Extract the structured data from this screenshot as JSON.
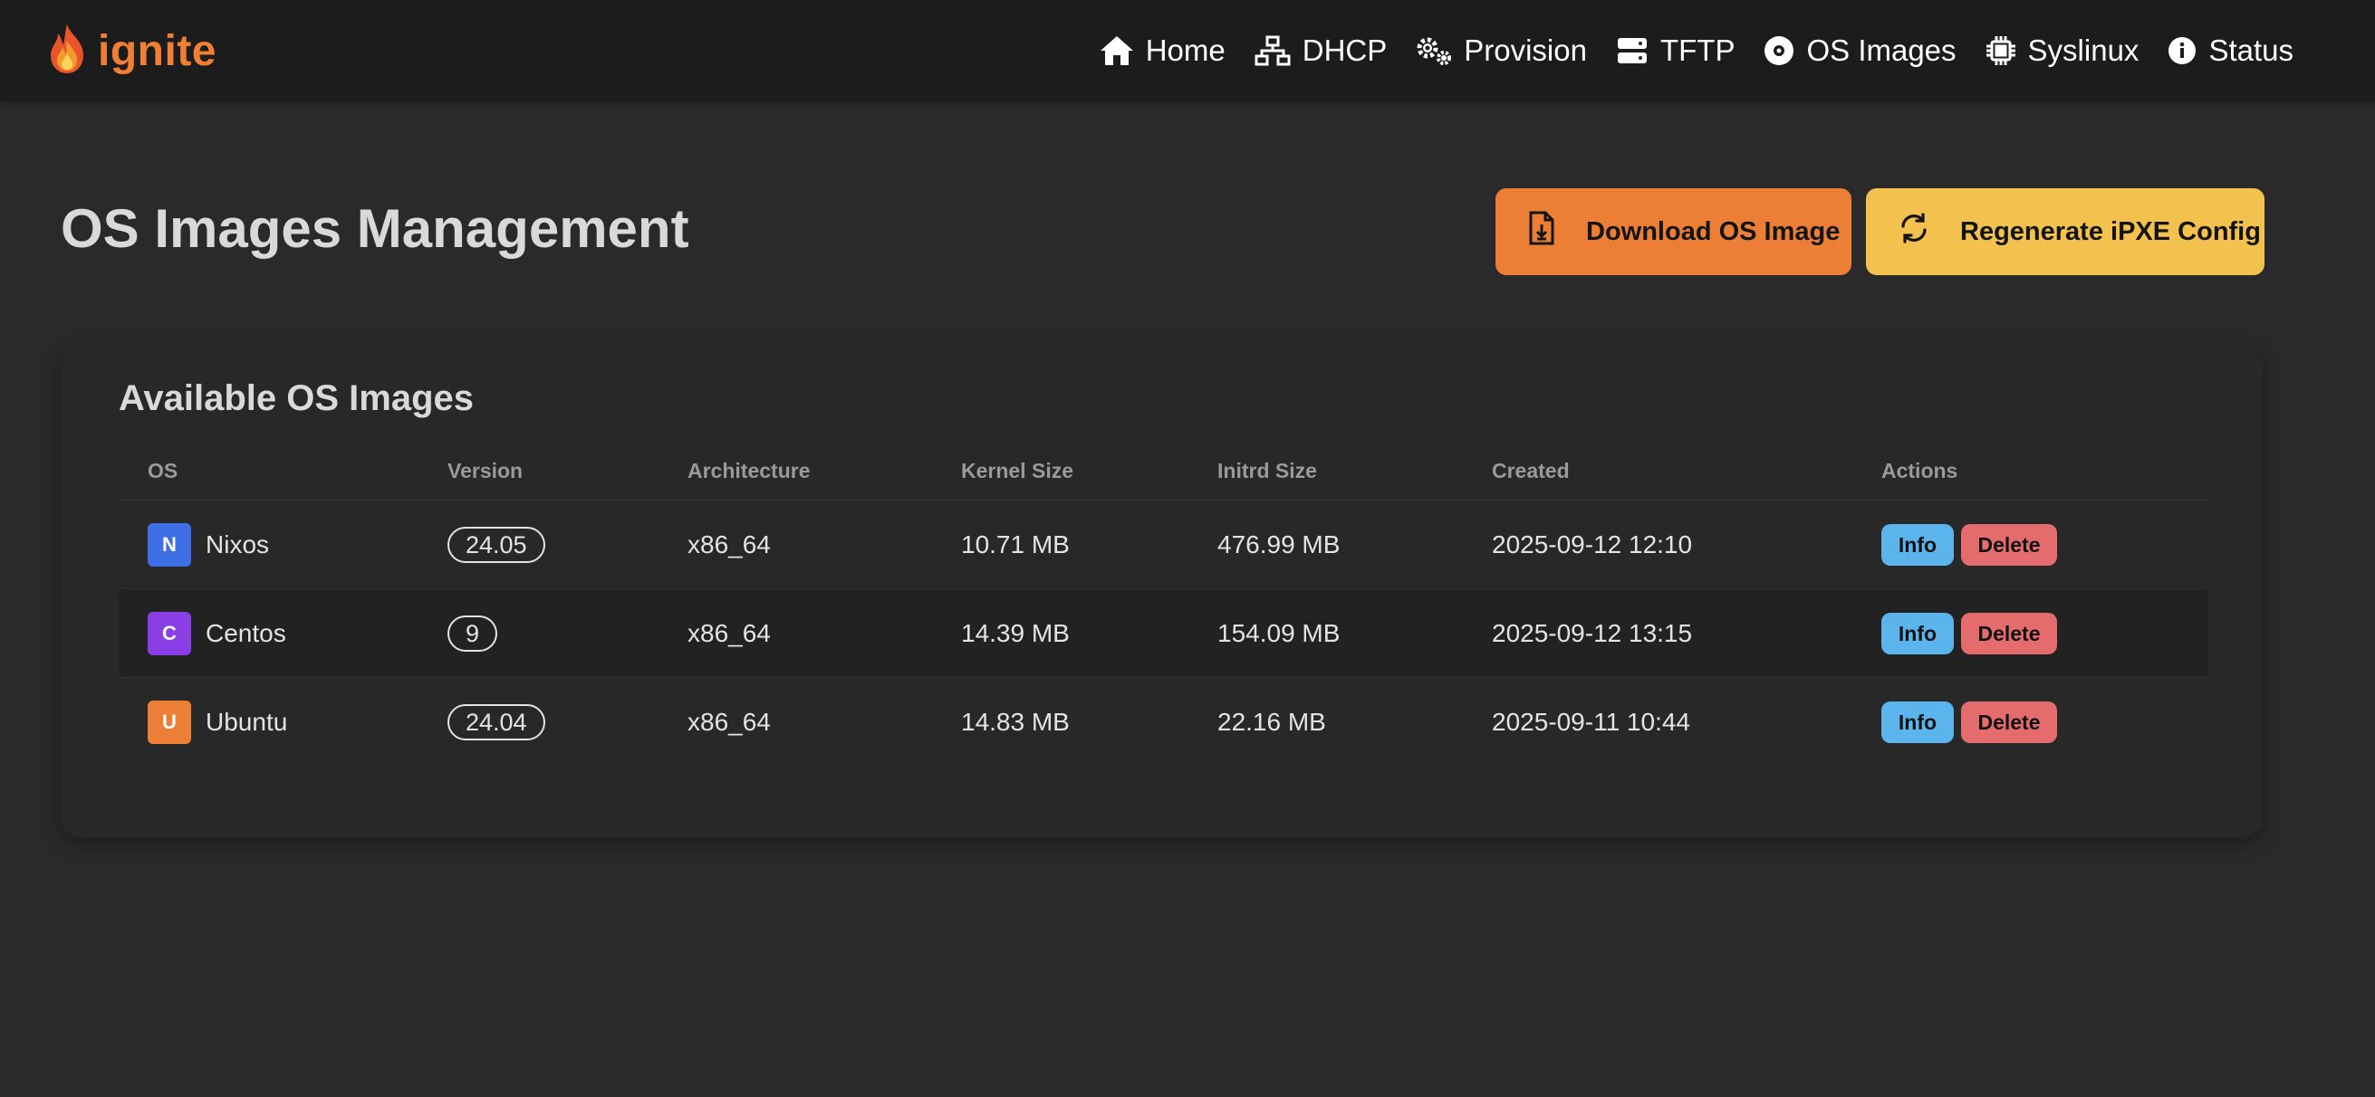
{
  "brand": {
    "name": "ignite",
    "color": "#f07f34"
  },
  "nav": [
    {
      "label": "Home",
      "icon": "home-icon"
    },
    {
      "label": "DHCP",
      "icon": "network-icon"
    },
    {
      "label": "Provision",
      "icon": "gears-icon"
    },
    {
      "label": "TFTP",
      "icon": "server-icon"
    },
    {
      "label": "OS Images",
      "icon": "disc-icon"
    },
    {
      "label": "Syslinux",
      "icon": "chip-icon"
    },
    {
      "label": "Status",
      "icon": "info-icon"
    }
  ],
  "page": {
    "title": "OS Images Management"
  },
  "actions": {
    "download_label": "Download OS Image",
    "regenerate_label": "Regenerate iPXE Config",
    "download_color": "#ec7f35",
    "regenerate_color": "#f2c14e"
  },
  "card": {
    "title": "Available OS Images"
  },
  "table": {
    "headers": [
      "OS",
      "Version",
      "Architecture",
      "Kernel Size",
      "Initrd Size",
      "Created",
      "Actions"
    ],
    "rows": [
      {
        "badge": "N",
        "badge_color": "#3f6fe6",
        "os": "Nixos",
        "version": "24.05",
        "arch": "x86_64",
        "kernel": "10.71 MB",
        "initrd": "476.99 MB",
        "created": "2025-09-12 12:10"
      },
      {
        "badge": "C",
        "badge_color": "#8a3fe6",
        "os": "Centos",
        "version": "9",
        "arch": "x86_64",
        "kernel": "14.39 MB",
        "initrd": "154.09 MB",
        "created": "2025-09-12 13:15"
      },
      {
        "badge": "U",
        "badge_color": "#ec7f35",
        "os": "Ubuntu",
        "version": "24.04",
        "arch": "x86_64",
        "kernel": "14.83 MB",
        "initrd": "22.16 MB",
        "created": "2025-09-11 10:44"
      }
    ],
    "info_label": "Info",
    "delete_label": "Delete"
  }
}
